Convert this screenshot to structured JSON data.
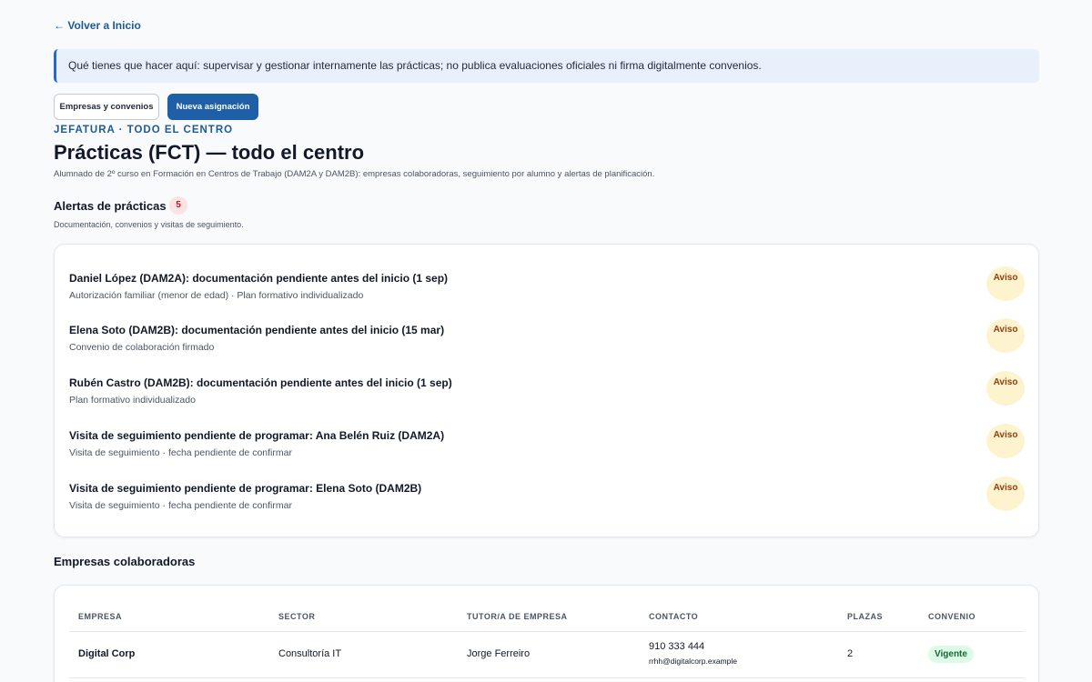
{
  "nav": {
    "back_link": "← Volver a Inicio"
  },
  "info_banner": "Qué tienes que hacer aquí: supervisar y gestionar internamente las prácticas; no publica evaluaciones oficiales ni firma digitalmente convenios.",
  "actions": {
    "companies_button": "Empresas y convenios",
    "new_assignment_button": "Nueva asignación"
  },
  "header": {
    "eyebrow": "JEFATURA · TODO EL CENTRO",
    "title": "Prácticas (FCT) — todo el centro",
    "subtitle": "Alumnado de 2º curso en Formación en Centros de Trabajo (DAM2A y DAM2B): empresas colaboradoras, seguimiento por alumno y alertas de planificación."
  },
  "alerts": {
    "title": "Alertas de prácticas",
    "count": "5",
    "subtitle": "Documentación, convenios y visitas de seguimiento.",
    "items": [
      {
        "title": "Daniel López (DAM2A): documentación pendiente antes del inicio (1 sep)",
        "desc": "Autorización familiar (menor de edad) · Plan formativo individualizado",
        "badge": "Aviso"
      },
      {
        "title": "Elena Soto (DAM2B): documentación pendiente antes del inicio (15 mar)",
        "desc": "Convenio de colaboración firmado",
        "badge": "Aviso"
      },
      {
        "title": "Rubén Castro (DAM2B): documentación pendiente antes del inicio (1 sep)",
        "desc": "Plan formativo individualizado",
        "badge": "Aviso"
      },
      {
        "title": "Visita de seguimiento pendiente de programar: Ana Belén Ruiz (DAM2A)",
        "desc": "Visita de seguimiento · fecha pendiente de confirmar",
        "badge": "Aviso"
      },
      {
        "title": "Visita de seguimiento pendiente de programar: Elena Soto (DAM2B)",
        "desc": "Visita de seguimiento · fecha pendiente de confirmar",
        "badge": "Aviso"
      }
    ]
  },
  "companies": {
    "title": "Empresas colaboradoras",
    "columns": [
      "EMPRESA",
      "SECTOR",
      "TUTOR/A DE EMPRESA",
      "CONTACTO",
      "PLAZAS",
      "CONVENIO"
    ],
    "rows": [
      {
        "name": "Digital Corp",
        "sector": "Consultoría IT",
        "tutor": "Jorge Ferreiro",
        "phone": "910 333 444",
        "email": "rrhh@digitalcorp.example",
        "slots": "2",
        "agreement": "Vigente"
      }
    ]
  },
  "colors": {
    "accent": "#1e5fa8",
    "banner_bg": "#e8f1fb",
    "warning_bg": "#fdf3cf",
    "warning_text": "#92400e",
    "success_bg": "#dcfce7",
    "success_text": "#166534",
    "alert_count_bg": "#fde2e2"
  }
}
